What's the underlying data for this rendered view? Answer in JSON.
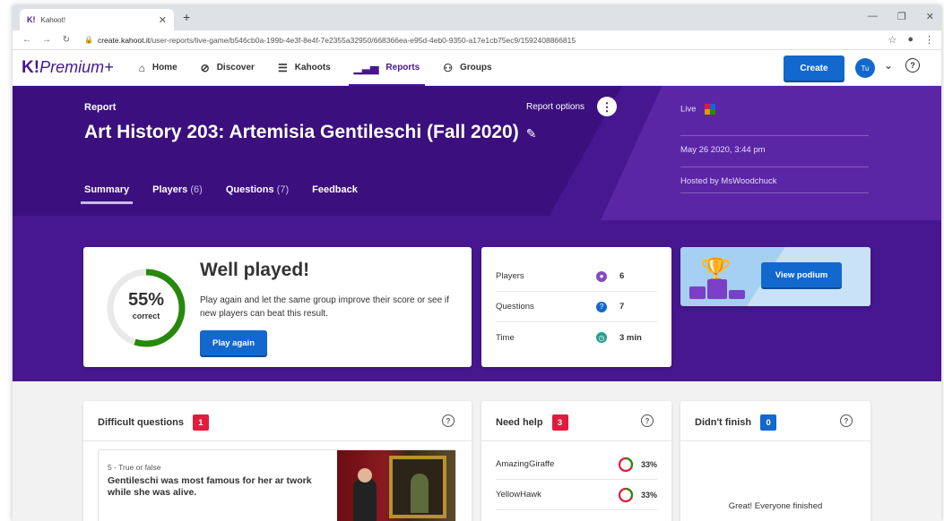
{
  "browser": {
    "tab_title": "Kahoot!",
    "tab_favicon": "K!",
    "url_host": "create.kahoot.it",
    "url_path": "/user-reports/live-game/b546cb0a-199b-4e3f-8e4f-7e2355a32950/668366ea-e95d-4eb0-9350-a17e1cb75ec9/1592408866815"
  },
  "nav": {
    "logo_k": "K!",
    "logo_text": "Premium+",
    "items": [
      {
        "label": "Home",
        "icon": "home-icon"
      },
      {
        "label": "Discover",
        "icon": "compass-icon"
      },
      {
        "label": "Kahoots",
        "icon": "list-icon"
      },
      {
        "label": "Reports",
        "icon": "chart-icon"
      },
      {
        "label": "Groups",
        "icon": "groups-icon"
      }
    ],
    "create_label": "Create",
    "avatar_initials": "Tu"
  },
  "report": {
    "label": "Report",
    "options_label": "Report options",
    "title": "Art History 203: Artemisia Gentileschi (Fall 2020)",
    "live_label": "Live",
    "date": "May 26 2020, 3:44 pm",
    "hosted_by": "Hosted by MsWoodchuck",
    "tabs": [
      {
        "label": "Summary",
        "count": ""
      },
      {
        "label": "Players",
        "count": "(6)"
      },
      {
        "label": "Questions",
        "count": "(7)"
      },
      {
        "label": "Feedback",
        "count": ""
      }
    ]
  },
  "score": {
    "percent_text": "55%",
    "percent_value": 55,
    "correct_label": "correct",
    "heading": "Well played!",
    "description": "Play again and let the same group improve their score or see if new players can beat this result.",
    "play_again_label": "Play again"
  },
  "stats": [
    {
      "label": "Players",
      "value": "6",
      "icon": "person-icon",
      "color": "#864cbf",
      "glyph": "●"
    },
    {
      "label": "Questions",
      "value": "7",
      "icon": "question-icon",
      "color": "#1368ce",
      "glyph": "?"
    },
    {
      "label": "Time",
      "value": "3 min",
      "icon": "clock-icon",
      "color": "#2a9d8f",
      "glyph": "◷"
    }
  ],
  "podium": {
    "view_label": "View podium"
  },
  "difficult": {
    "title": "Difficult questions",
    "count": "1",
    "question_type": "5 - True or false",
    "question_text": "Gentileschi was most famous for her ar twork while she was alive."
  },
  "need_help": {
    "title": "Need help",
    "count": "3",
    "players": [
      {
        "name": "AmazingGiraffe",
        "percent": "33%",
        "percent_value": 33
      },
      {
        "name": "YellowHawk",
        "percent": "33%",
        "percent_value": 33
      }
    ]
  },
  "didnt_finish": {
    "title": "Didn't finish",
    "count": "0",
    "message": "Great! Everyone finished"
  },
  "colors": {
    "purple": "#46178f",
    "blue": "#1368ce",
    "red": "#e21b3c",
    "green": "#26890c"
  }
}
